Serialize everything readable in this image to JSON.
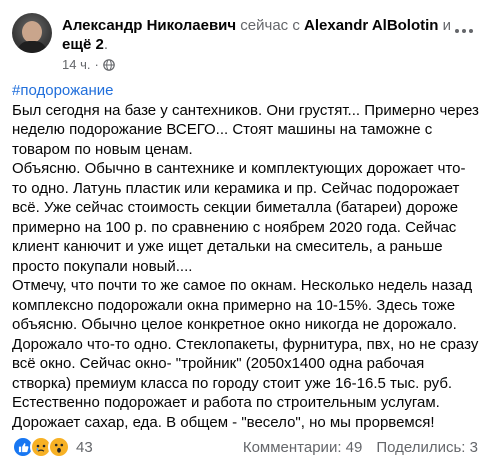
{
  "header": {
    "author": "Александр Николаевич",
    "action": "сейчас с",
    "tagged": "Alexandr AlBolotin",
    "conj": "и",
    "others": "ещё 2",
    "period": ".",
    "time": "14 ч.",
    "separator": "·",
    "privacy_icon": "globe-icon",
    "more_icon": "more-options-icon"
  },
  "post": {
    "hashtag": "#подорожание",
    "paragraphs": [
      "Был сегодня на базе у сантехников. Они грустят... Примерно через неделю подорожание ВСЕГО...  Стоят машины на таможне с товаром по новым ценам.",
      "Объясню. Обычно в сантехнике и комплектующих дорожает что-то одно. Латунь  пластик или керамика и пр. Сейчас подорожает всё. Уже сейчас стоимость секции биметалла (батареи) дороже примерно на 100 р. по сравнению с ноябрем 2020 года. Сейчас клиент канючит и уже ищет детальки на смеситель, а раньше просто покупали новый....",
      "Отмечу, что почти то же самое по окнам. Несколько недель назад комплексно подорожали окна примерно на 10-15%. Здесь тоже объясню. Обычно целое конкретное окно никогда не дорожало. Дорожало что-то одно. Стеклопакеты, фурнитура, пвх, но не сразу всё окно. Сейчас окно-  \"тройник\" (2050х1400 одна рабочая створка) премиум класса по городу стоит уже 16-16.5 тыс. руб.",
      "Естественно подорожает и работа по строительным услугам.",
      "Дорожает сахар, еда. В общем - \"весело\", но мы прорвемся!"
    ]
  },
  "footer": {
    "reaction_icons": [
      "like-reaction-icon",
      "sad-reaction-icon",
      "wow-reaction-icon"
    ],
    "reaction_count": "43",
    "comments": "Комментарии: 49",
    "shares": "Поделились: 3"
  },
  "colors": {
    "text": "#050505",
    "muted": "#65676b",
    "link": "#216fdb",
    "like": "#1877f2",
    "emoji": "#f7b125"
  }
}
